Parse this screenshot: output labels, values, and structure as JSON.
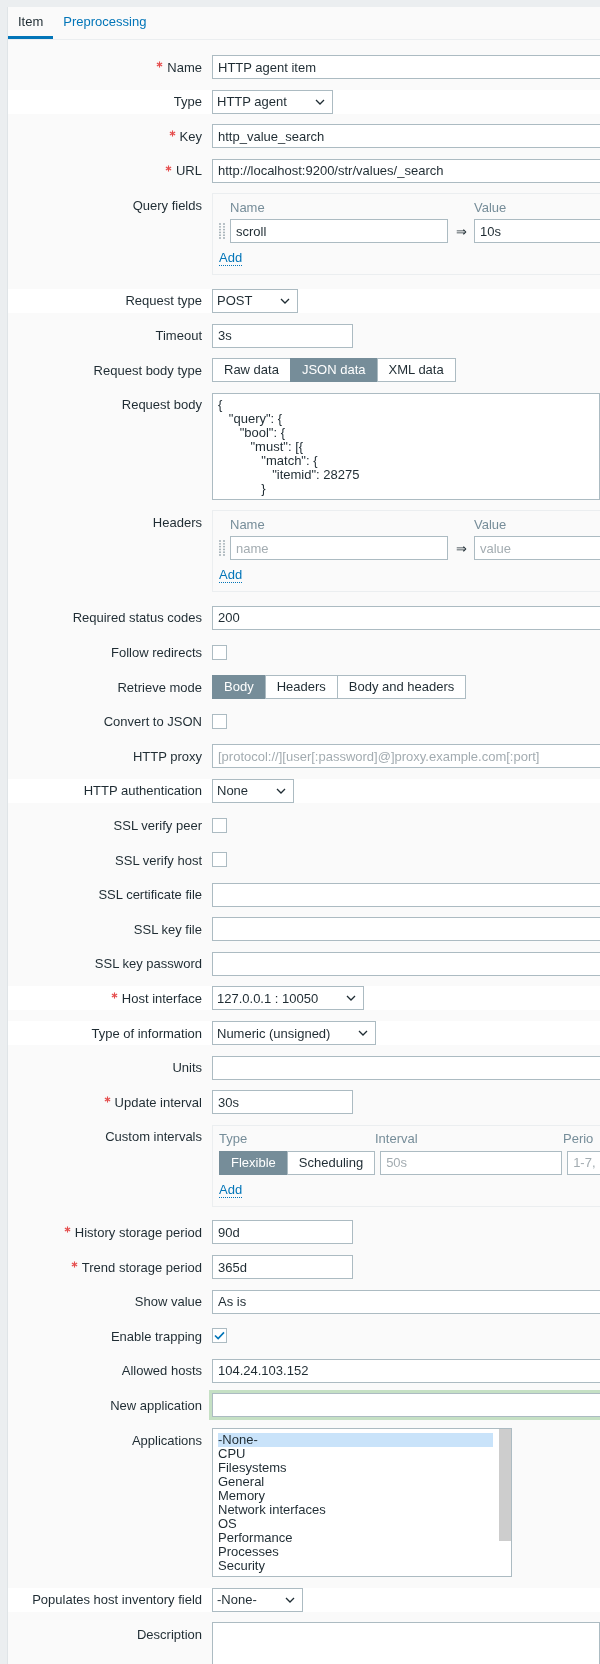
{
  "tabs": [
    {
      "label": "Item",
      "selected": true
    },
    {
      "label": "Preprocessing",
      "selected": false
    }
  ],
  "form": {
    "rows": [
      {
        "label": "Name",
        "required": true,
        "kind": "text",
        "value": "HTTP agent item"
      },
      {
        "label": "Type",
        "required": false,
        "kind": "select",
        "value": "HTTP agent"
      },
      {
        "label": "Key",
        "required": true,
        "kind": "text",
        "value": "http_value_search"
      },
      {
        "label": "URL",
        "required": true,
        "kind": "text",
        "value": "http://localhost:9200/str/values/_search"
      },
      {
        "label": "Query fields",
        "required": false,
        "kind": "pairs",
        "columns": [
          "Name",
          "Value"
        ],
        "separator": "⇒",
        "rows": [
          {
            "name": {
              "value": "scroll"
            },
            "value": {
              "value": "10s"
            }
          }
        ],
        "add": "Add"
      },
      {
        "label": "Request type",
        "required": false,
        "kind": "select",
        "value": "POST"
      },
      {
        "label": "Timeout",
        "required": false,
        "kind": "short",
        "value": "3s"
      },
      {
        "label": "Request body type",
        "required": false,
        "kind": "segmented",
        "options": [
          {
            "label": "Raw data",
            "selected": false
          },
          {
            "label": "JSON data",
            "selected": true
          },
          {
            "label": "XML data",
            "selected": false
          }
        ]
      },
      {
        "label": "Request body",
        "required": false,
        "kind": "textarea",
        "value": "{\n   \"query\": {\n      \"bool\": {\n         \"must\": [{\n            \"match\": {\n               \"itemid\": 28275\n            }"
      },
      {
        "label": "Headers",
        "required": false,
        "kind": "pairs",
        "columns": [
          "Name",
          "Value"
        ],
        "separator": "⇒",
        "rows": [
          {
            "name": {
              "placeholder": "name"
            },
            "value": {
              "placeholder": "value"
            }
          }
        ],
        "add": "Add"
      },
      {
        "label": "Required status codes",
        "required": false,
        "kind": "text",
        "value": "200"
      },
      {
        "label": "Follow redirects",
        "required": false,
        "kind": "checkbox",
        "checked": false
      },
      {
        "label": "Retrieve mode",
        "required": false,
        "kind": "segmented",
        "options": [
          {
            "label": "Body",
            "selected": true
          },
          {
            "label": "Headers",
            "selected": false
          },
          {
            "label": "Body and headers",
            "selected": false
          }
        ]
      },
      {
        "label": "Convert to JSON",
        "required": false,
        "kind": "checkbox",
        "checked": false
      },
      {
        "label": "HTTP proxy",
        "required": false,
        "kind": "text",
        "placeholder": "[protocol://][user[:password]@]proxy.example.com[:port]"
      },
      {
        "label": "HTTP authentication",
        "required": false,
        "kind": "select",
        "value": "None"
      },
      {
        "label": "SSL verify peer",
        "required": false,
        "kind": "checkbox",
        "checked": false
      },
      {
        "label": "SSL verify host",
        "required": false,
        "kind": "checkbox",
        "checked": false
      },
      {
        "label": "SSL certificate file",
        "required": false,
        "kind": "text"
      },
      {
        "label": "SSL key file",
        "required": false,
        "kind": "text"
      },
      {
        "label": "SSL key password",
        "required": false,
        "kind": "text"
      },
      {
        "label": "Host interface",
        "required": true,
        "kind": "select",
        "value": "127.0.0.1 : 10050"
      },
      {
        "label": "Type of information",
        "required": false,
        "kind": "select",
        "value": "Numeric (unsigned)"
      },
      {
        "label": "Units",
        "required": false,
        "kind": "text"
      },
      {
        "label": "Update interval",
        "required": true,
        "kind": "short",
        "value": "30s"
      },
      {
        "label": "Custom intervals",
        "required": false,
        "kind": "intervals",
        "columns": [
          "Type",
          "Interval",
          "Perio"
        ],
        "rows": [
          {
            "modes": [
              {
                "label": "Flexible",
                "selected": true
              },
              {
                "label": "Scheduling",
                "selected": false
              }
            ],
            "interval": {
              "placeholder": "50s"
            },
            "period": {
              "placeholder": "1-7,"
            }
          }
        ],
        "add": "Add"
      },
      {
        "label": "History storage period",
        "required": true,
        "kind": "short",
        "value": "90d"
      },
      {
        "label": "Trend storage period",
        "required": true,
        "kind": "short",
        "value": "365d"
      },
      {
        "label": "Show value",
        "required": false,
        "kind": "text",
        "value": "As is"
      },
      {
        "label": "Enable trapping",
        "required": false,
        "kind": "checkbox",
        "checked": true
      },
      {
        "label": "Allowed hosts",
        "required": false,
        "kind": "text",
        "value": "104.24.103.152"
      },
      {
        "label": "New application",
        "required": false,
        "kind": "text",
        "focused": true
      },
      {
        "label": "Applications",
        "required": false,
        "kind": "listbox",
        "items": [
          {
            "label": "-None-",
            "selected": true
          },
          {
            "label": "CPU",
            "selected": false
          },
          {
            "label": "Filesystems",
            "selected": false
          },
          {
            "label": "General",
            "selected": false
          },
          {
            "label": "Memory",
            "selected": false
          },
          {
            "label": "Network interfaces",
            "selected": false
          },
          {
            "label": "OS",
            "selected": false
          },
          {
            "label": "Performance",
            "selected": false
          },
          {
            "label": "Processes",
            "selected": false
          },
          {
            "label": "Security",
            "selected": false
          }
        ]
      },
      {
        "label": "Populates host inventory field",
        "required": false,
        "kind": "select",
        "value": "-None-"
      },
      {
        "label": "Description",
        "required": false,
        "kind": "textarea"
      }
    ]
  }
}
